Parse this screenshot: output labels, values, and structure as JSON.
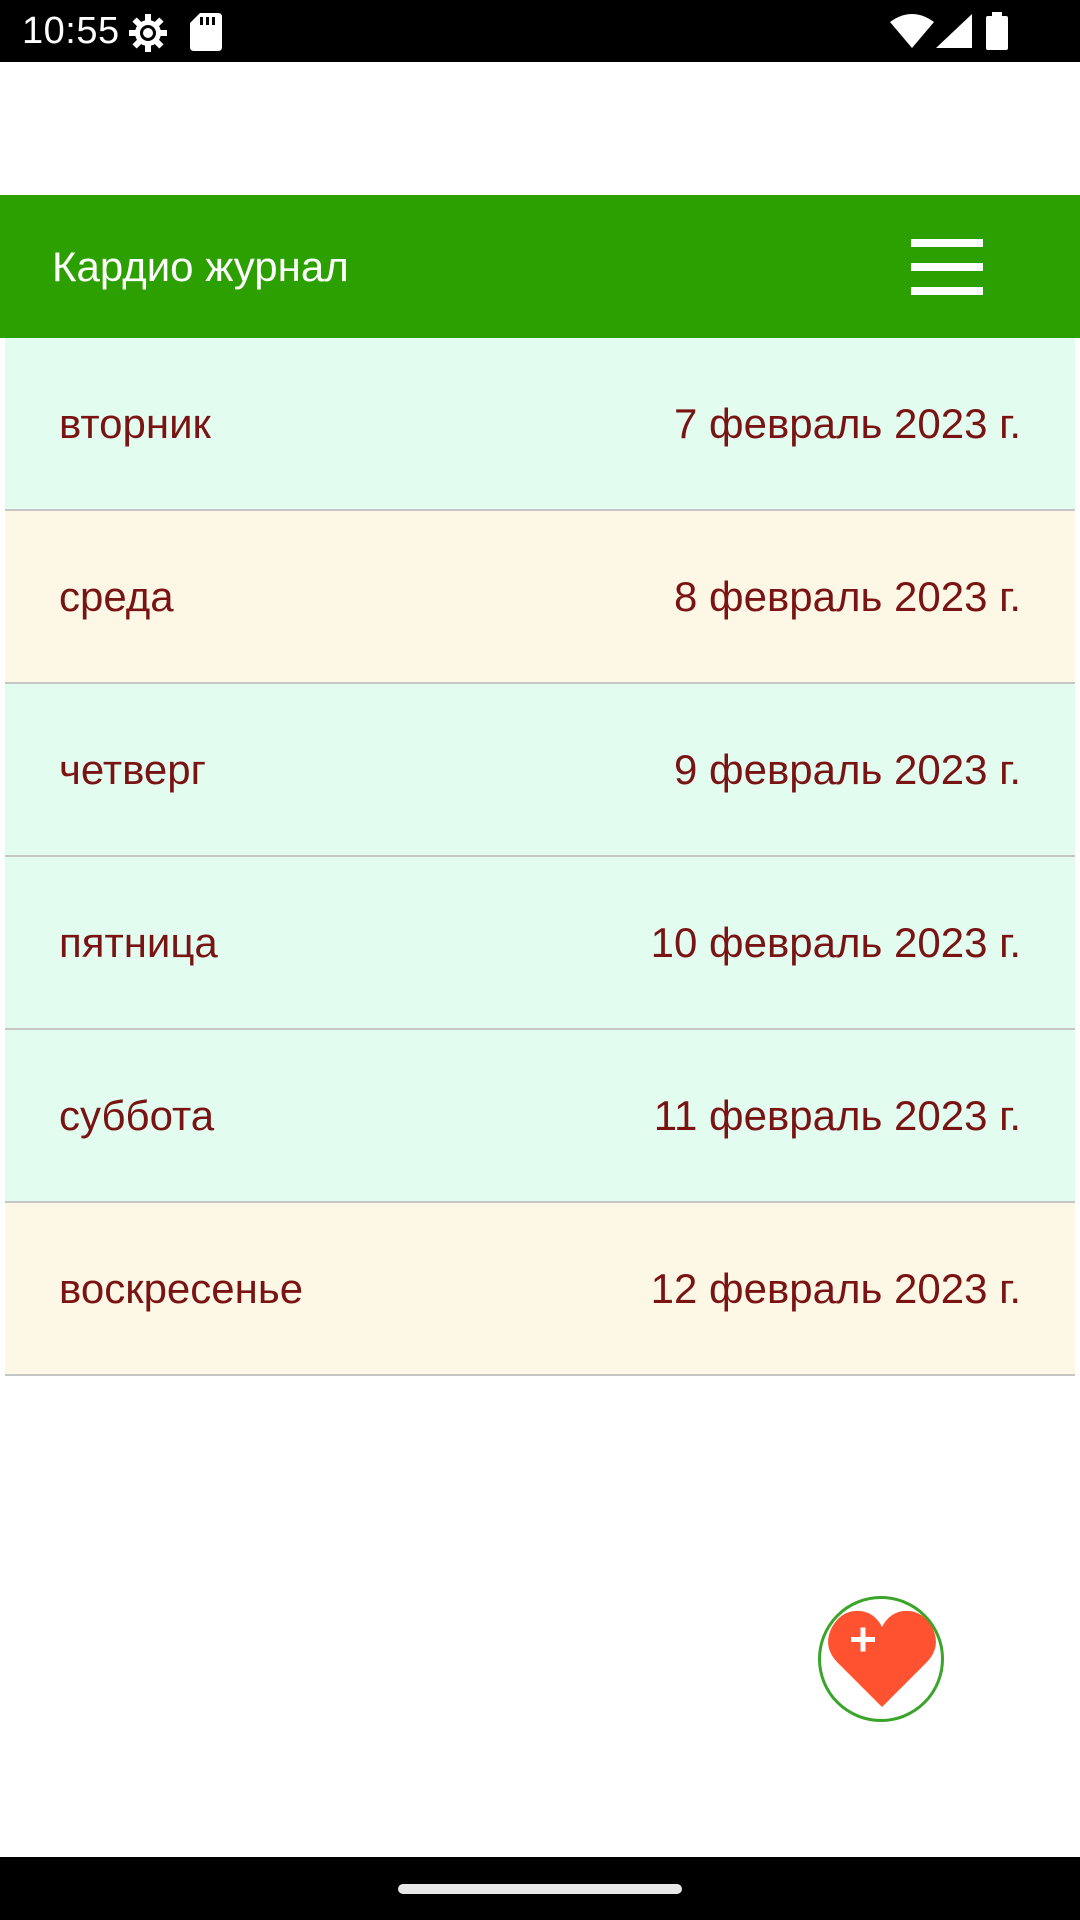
{
  "status_bar": {
    "time": "10:55"
  },
  "app_bar": {
    "title": "Кардио журнал"
  },
  "days": [
    {
      "day": "вторник",
      "date": "7 февраль 2023 г.",
      "tint": "green"
    },
    {
      "day": "среда",
      "date": "8 февраль 2023 г.",
      "tint": "cream"
    },
    {
      "day": "четверг",
      "date": "9 февраль 2023 г.",
      "tint": "green"
    },
    {
      "day": "пятница",
      "date": "10 февраль 2023 г.",
      "tint": "green"
    },
    {
      "day": "суббота",
      "date": "11 февраль 2023 г.",
      "tint": "green"
    },
    {
      "day": "воскресенье",
      "date": "12 февраль 2023 г.",
      "tint": "cream"
    }
  ],
  "colors": {
    "app_bar": "#2ca000",
    "row_green": "#e2fcf0",
    "row_cream": "#fdf8e6",
    "text": "#7a1414",
    "heart": "#ff5230",
    "fab_border": "#3aa52a"
  },
  "icons": {
    "menu": "hamburger-menu-icon",
    "fab": "heart-plus-icon"
  }
}
